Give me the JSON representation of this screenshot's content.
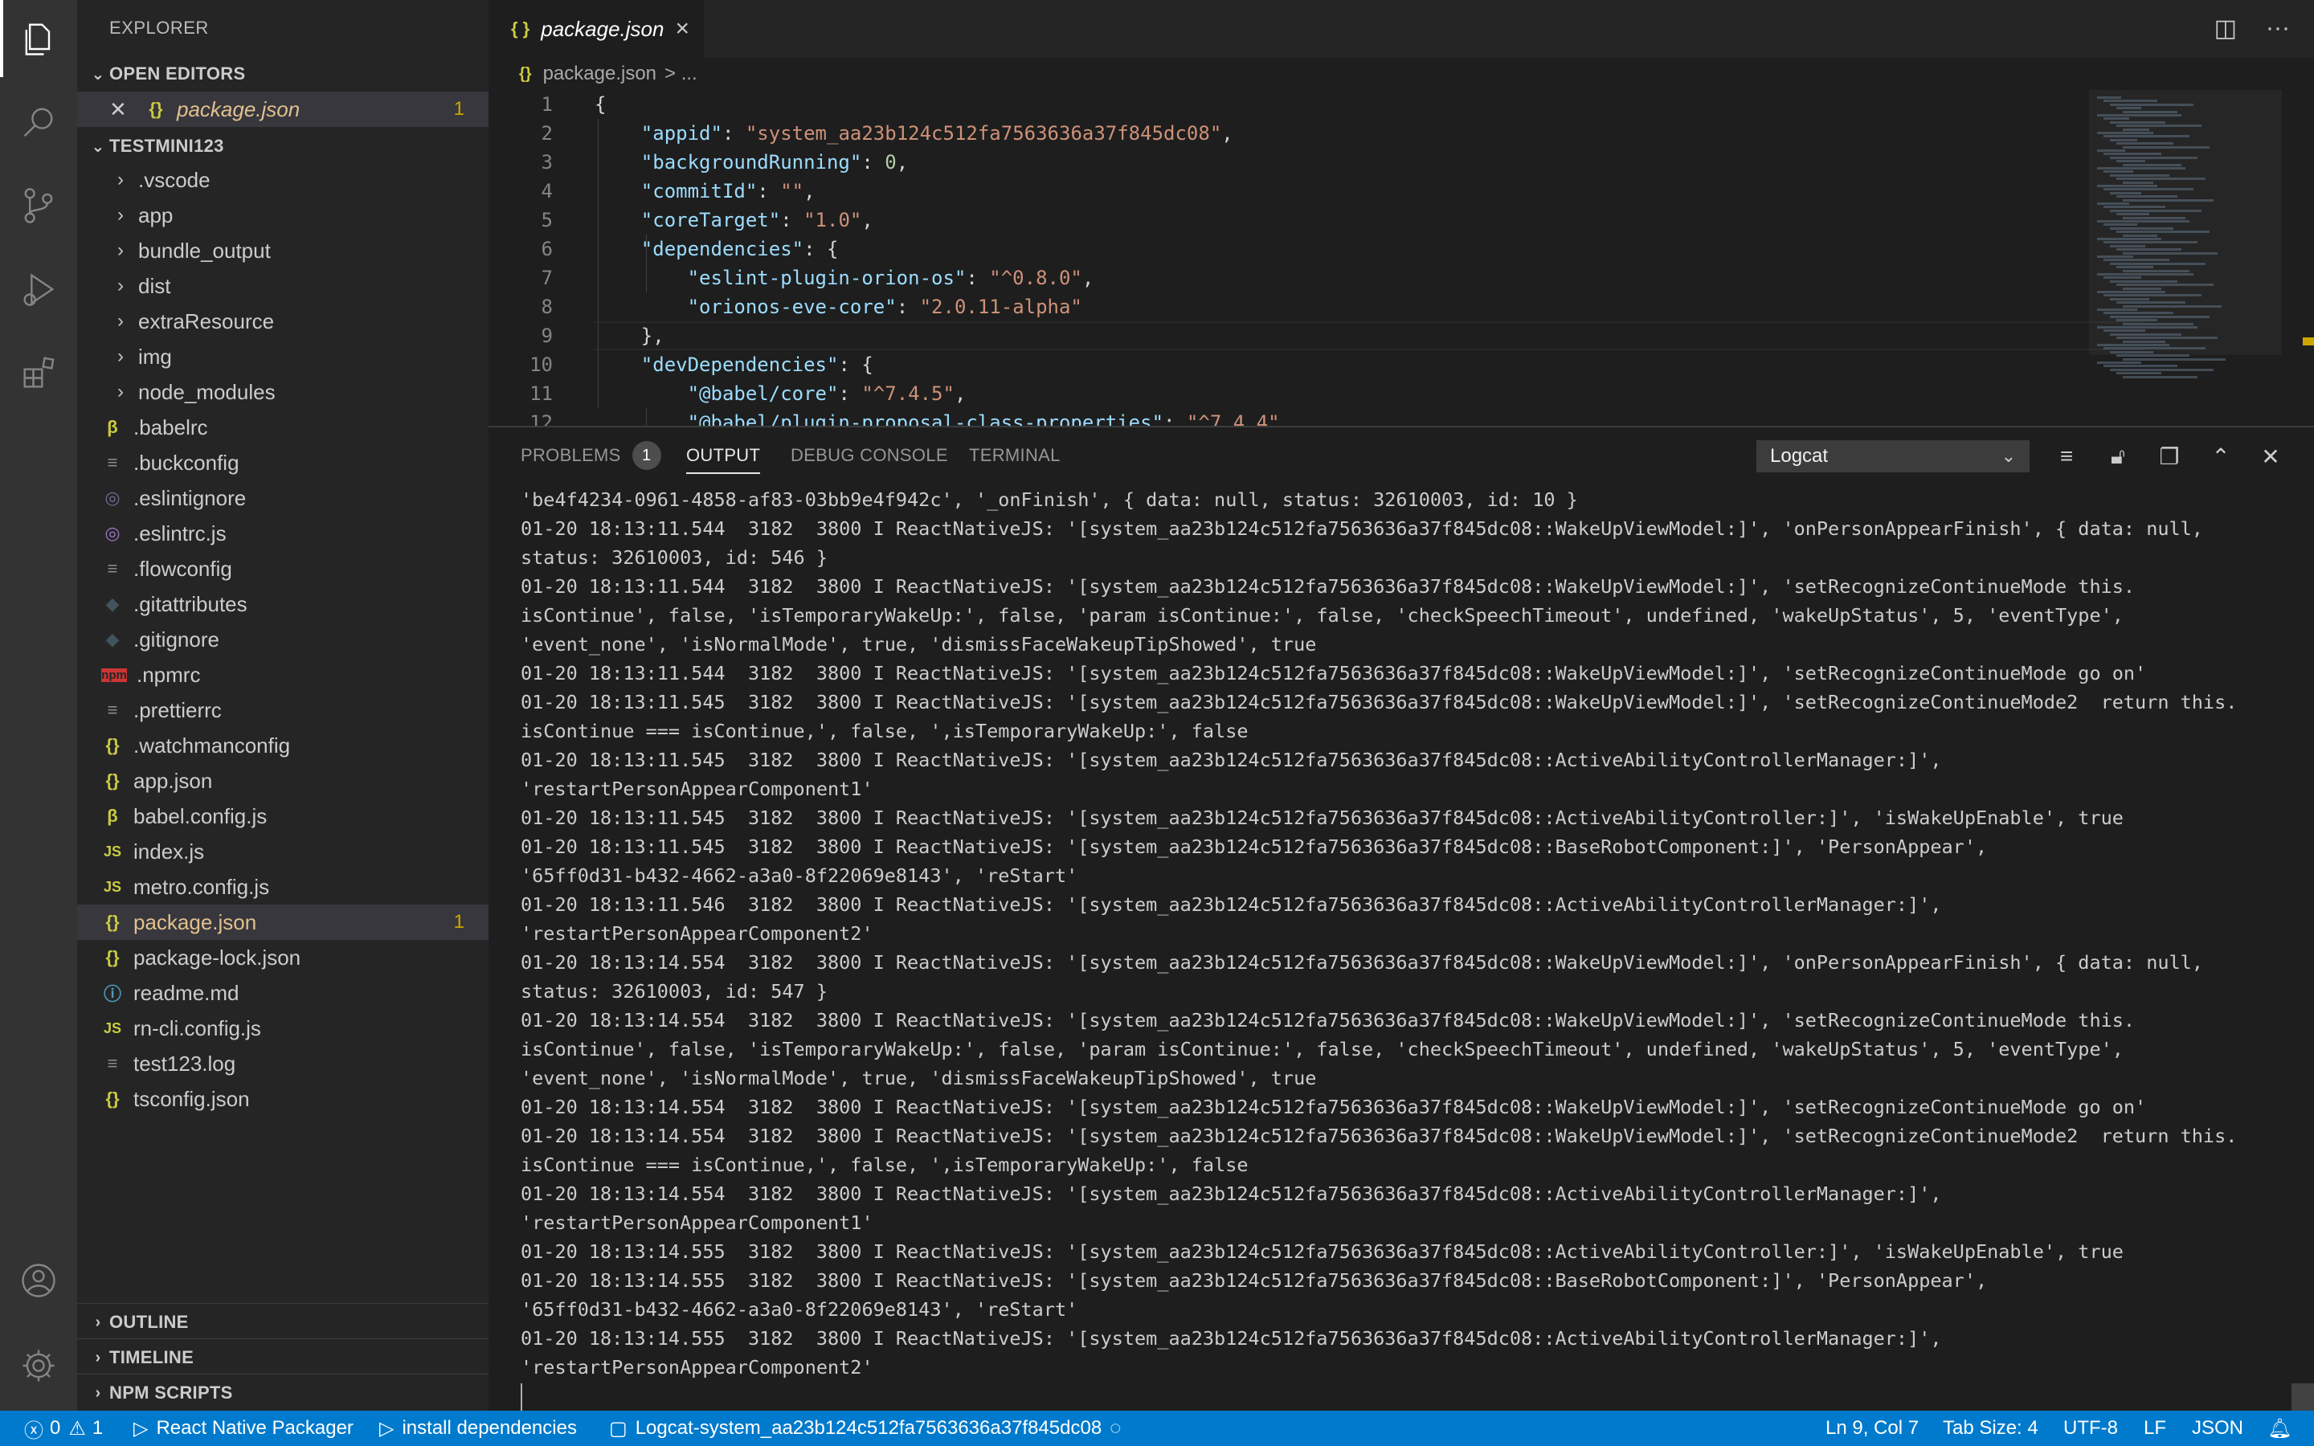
{
  "activity_bar": {
    "items": [
      "files-icon",
      "search-icon",
      "source-control-icon",
      "run-debug-icon",
      "extensions-icon"
    ],
    "bottom_items": [
      "account-icon",
      "manage-gear-icon"
    ]
  },
  "sidebar": {
    "title": "EXPLORER",
    "open_editors": {
      "label": "OPEN EDITORS",
      "items": [
        {
          "name": "package.json",
          "badge": "1"
        }
      ]
    },
    "project": {
      "label": "TESTMINI123",
      "folders": [
        ".vscode",
        "app",
        "bundle_output",
        "dist",
        "extraResource",
        "img",
        "node_modules"
      ],
      "files": [
        {
          "name": ".babelrc",
          "icon": "β",
          "color": "#cbcb41"
        },
        {
          "name": ".buckconfig",
          "icon": "≡",
          "color": "#8a8a8a"
        },
        {
          "name": ".eslintignore",
          "icon": "◎",
          "color": "#6d6d8f"
        },
        {
          "name": ".eslintrc.js",
          "icon": "◎",
          "color": "#a074c4"
        },
        {
          "name": ".flowconfig",
          "icon": "≡",
          "color": "#8a8a8a"
        },
        {
          "name": ".gitattributes",
          "icon": "◆",
          "color": "#41535b"
        },
        {
          "name": ".gitignore",
          "icon": "◆",
          "color": "#41535b"
        },
        {
          "name": ".npmrc",
          "icon": "npm",
          "color": "#cc3534"
        },
        {
          "name": ".prettierrc",
          "icon": "≡",
          "color": "#8a8a8a"
        },
        {
          "name": ".watchmanconfig",
          "icon": "{}",
          "color": "#cbcb41"
        },
        {
          "name": "app.json",
          "icon": "{}",
          "color": "#cbcb41"
        },
        {
          "name": "babel.config.js",
          "icon": "β",
          "color": "#cbcb41"
        },
        {
          "name": "index.js",
          "icon": "JS",
          "color": "#cbcb41"
        },
        {
          "name": "metro.config.js",
          "icon": "JS",
          "color": "#cbcb41"
        },
        {
          "name": "package.json",
          "icon": "{}",
          "color": "#cbcb41",
          "badge": "1",
          "selected": true
        },
        {
          "name": "package-lock.json",
          "icon": "{}",
          "color": "#cbcb41"
        },
        {
          "name": "readme.md",
          "icon": "ⓘ",
          "color": "#519aba"
        },
        {
          "name": "rn-cli.config.js",
          "icon": "JS",
          "color": "#cbcb41"
        },
        {
          "name": "test123.log",
          "icon": "≡",
          "color": "#8a8a8a"
        },
        {
          "name": "tsconfig.json",
          "icon": "{}",
          "color": "#cbcb41"
        }
      ]
    },
    "outline_label": "OUTLINE",
    "timeline_label": "TIMELINE",
    "npm_scripts_label": "NPM SCRIPTS"
  },
  "editor": {
    "tab_label": "package.json",
    "tab_icon": "{ }",
    "breadcrumb_file": "package.json",
    "breadcrumb_rest": "> ...",
    "lines": [
      {
        "n": "1",
        "parts": [
          [
            "p",
            "{"
          ]
        ]
      },
      {
        "n": "2",
        "parts": [
          [
            "p",
            "    "
          ],
          [
            "k",
            "\"appid\""
          ],
          [
            "p",
            ": "
          ],
          [
            "s",
            "\"system_aa23b124c512fa7563636a37f845dc08\""
          ],
          [
            "p",
            ","
          ]
        ]
      },
      {
        "n": "3",
        "parts": [
          [
            "p",
            "    "
          ],
          [
            "k",
            "\"backgroundRunning\""
          ],
          [
            "p",
            ": "
          ],
          [
            "n",
            "0"
          ],
          [
            "p",
            ","
          ]
        ]
      },
      {
        "n": "4",
        "parts": [
          [
            "p",
            "    "
          ],
          [
            "k",
            "\"commitId\""
          ],
          [
            "p",
            ": "
          ],
          [
            "s",
            "\"\""
          ],
          [
            "p",
            ","
          ]
        ]
      },
      {
        "n": "5",
        "parts": [
          [
            "p",
            "    "
          ],
          [
            "k",
            "\"coreTarget\""
          ],
          [
            "p",
            ": "
          ],
          [
            "s",
            "\"1.0\""
          ],
          [
            "p",
            ","
          ]
        ]
      },
      {
        "n": "6",
        "parts": [
          [
            "p",
            "    "
          ],
          [
            "k",
            "\"dependencies\""
          ],
          [
            "p",
            ": {"
          ]
        ]
      },
      {
        "n": "7",
        "parts": [
          [
            "p",
            "        "
          ],
          [
            "k",
            "\"eslint-plugin-orion-os\""
          ],
          [
            "p",
            ": "
          ],
          [
            "s",
            "\"^0.8.0\""
          ],
          [
            "p",
            ","
          ]
        ]
      },
      {
        "n": "8",
        "parts": [
          [
            "p",
            "        "
          ],
          [
            "k",
            "\"orionos-eve-core\""
          ],
          [
            "p",
            ": "
          ],
          [
            "s",
            "\"2.0.11-alpha\""
          ]
        ]
      },
      {
        "n": "9",
        "parts": [
          [
            "p",
            "    },"
          ]
        ]
      },
      {
        "n": "10",
        "parts": [
          [
            "p",
            "    "
          ],
          [
            "k",
            "\"devDependencies\""
          ],
          [
            "p",
            ": {"
          ]
        ]
      },
      {
        "n": "11",
        "parts": [
          [
            "p",
            "        "
          ],
          [
            "k",
            "\"@babel/core\""
          ],
          [
            "p",
            ": "
          ],
          [
            "s",
            "\"^7.4.5\""
          ],
          [
            "p",
            ","
          ]
        ]
      },
      {
        "n": "12",
        "parts": [
          [
            "p",
            "        "
          ],
          [
            "k",
            "\"@babel/plugin-proposal-class-properties\""
          ],
          [
            "p",
            ": "
          ],
          [
            "s",
            "\"^7.4.4\""
          ],
          [
            "p",
            ","
          ]
        ]
      }
    ]
  },
  "panel": {
    "tabs": [
      {
        "label": "PROBLEMS",
        "count": "1"
      },
      {
        "label": "OUTPUT",
        "active": true
      },
      {
        "label": "DEBUG CONSOLE"
      },
      {
        "label": "TERMINAL"
      }
    ],
    "channel": "Logcat",
    "output_lines": [
      "'be4f4234-0961-4858-af83-03bb9e4f942c', '_onFinish', { data: null, status: 32610003, id: 10 }",
      "01-20 18:13:11.544  3182  3800 I ReactNativeJS: '[system_aa23b124c512fa7563636a37f845dc08::WakeUpViewModel:]', 'onPersonAppearFinish', { data: null,",
      "status: 32610003, id: 546 }",
      "01-20 18:13:11.544  3182  3800 I ReactNativeJS: '[system_aa23b124c512fa7563636a37f845dc08::WakeUpViewModel:]', 'setRecognizeContinueMode this.",
      "isContinue', false, 'isTemporaryWakeUp:', false, 'param isContinue:', false, 'checkSpeechTimeout', undefined, 'wakeUpStatus', 5, 'eventType',",
      "'event_none', 'isNormalMode', true, 'dismissFaceWakeupTipShowed', true",
      "01-20 18:13:11.544  3182  3800 I ReactNativeJS: '[system_aa23b124c512fa7563636a37f845dc08::WakeUpViewModel:]', 'setRecognizeContinueMode go on'",
      "01-20 18:13:11.545  3182  3800 I ReactNativeJS: '[system_aa23b124c512fa7563636a37f845dc08::WakeUpViewModel:]', 'setRecognizeContinueMode2  return this.",
      "isContinue === isContinue,', false, ',isTemporaryWakeUp:', false",
      "01-20 18:13:11.545  3182  3800 I ReactNativeJS: '[system_aa23b124c512fa7563636a37f845dc08::ActiveAbilityControllerManager:]',",
      "'restartPersonAppearComponent1'",
      "01-20 18:13:11.545  3182  3800 I ReactNativeJS: '[system_aa23b124c512fa7563636a37f845dc08::ActiveAbilityController:]', 'isWakeUpEnable', true",
      "01-20 18:13:11.545  3182  3800 I ReactNativeJS: '[system_aa23b124c512fa7563636a37f845dc08::BaseRobotComponent:]', 'PersonAppear',",
      "'65ff0d31-b432-4662-a3a0-8f22069e8143', 'reStart'",
      "01-20 18:13:11.546  3182  3800 I ReactNativeJS: '[system_aa23b124c512fa7563636a37f845dc08::ActiveAbilityControllerManager:]',",
      "'restartPersonAppearComponent2'",
      "01-20 18:13:14.554  3182  3800 I ReactNativeJS: '[system_aa23b124c512fa7563636a37f845dc08::WakeUpViewModel:]', 'onPersonAppearFinish', { data: null,",
      "status: 32610003, id: 547 }",
      "01-20 18:13:14.554  3182  3800 I ReactNativeJS: '[system_aa23b124c512fa7563636a37f845dc08::WakeUpViewModel:]', 'setRecognizeContinueMode this.",
      "isContinue', false, 'isTemporaryWakeUp:', false, 'param isContinue:', false, 'checkSpeechTimeout', undefined, 'wakeUpStatus', 5, 'eventType',",
      "'event_none', 'isNormalMode', true, 'dismissFaceWakeupTipShowed', true",
      "01-20 18:13:14.554  3182  3800 I ReactNativeJS: '[system_aa23b124c512fa7563636a37f845dc08::WakeUpViewModel:]', 'setRecognizeContinueMode go on'",
      "01-20 18:13:14.554  3182  3800 I ReactNativeJS: '[system_aa23b124c512fa7563636a37f845dc08::WakeUpViewModel:]', 'setRecognizeContinueMode2  return this.",
      "isContinue === isContinue,', false, ',isTemporaryWakeUp:', false",
      "01-20 18:13:14.554  3182  3800 I ReactNativeJS: '[system_aa23b124c512fa7563636a37f845dc08::ActiveAbilityControllerManager:]',",
      "'restartPersonAppearComponent1'",
      "01-20 18:13:14.555  3182  3800 I ReactNativeJS: '[system_aa23b124c512fa7563636a37f845dc08::ActiveAbilityController:]', 'isWakeUpEnable', true",
      "01-20 18:13:14.555  3182  3800 I ReactNativeJS: '[system_aa23b124c512fa7563636a37f845dc08::BaseRobotComponent:]', 'PersonAppear',",
      "'65ff0d31-b432-4662-a3a0-8f22069e8143', 'reStart'",
      "01-20 18:13:14.555  3182  3800 I ReactNativeJS: '[system_aa23b124c512fa7563636a37f845dc08::ActiveAbilityControllerManager:]',",
      "'restartPersonAppearComponent2'"
    ]
  },
  "status_bar": {
    "errors": "0",
    "warnings": "1",
    "packager": "React Native Packager",
    "install": "install dependencies",
    "logcat": "Logcat-system_aa23b124c512fa7563636a37f845dc08",
    "position": "Ln 9, Col 7",
    "tab_size": "Tab Size: 4",
    "encoding": "UTF-8",
    "eol": "LF",
    "language": "JSON"
  }
}
